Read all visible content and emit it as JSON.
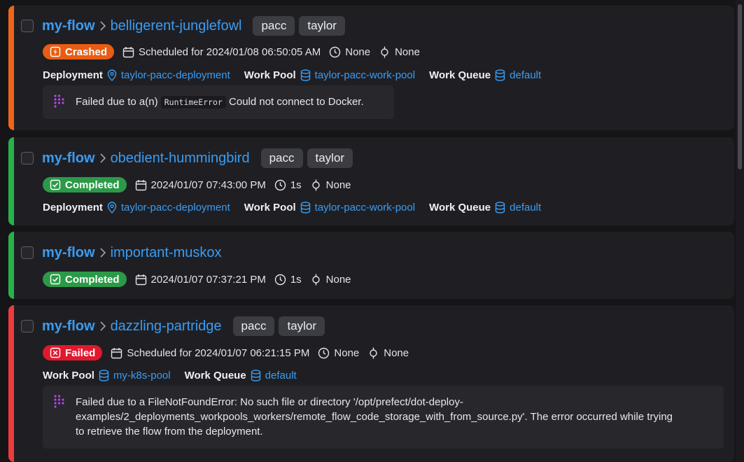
{
  "colors": {
    "crashed": "#e85d13",
    "completed": "#2b9a48",
    "failed": "#e1192e",
    "bar_crashed": "#f0641a",
    "bar_completed": "#26b24a",
    "bar_failed": "#ef3b3b",
    "link": "#3b9cf2",
    "card": "#1f1f23",
    "background": "#151518"
  },
  "runs": [
    {
      "flow": "my-flow",
      "run": "belligerent-junglefowl",
      "tags": [
        "pacc",
        "taylor"
      ],
      "state": "Crashed",
      "state_icon": "lightning-icon",
      "time": "Scheduled for 2024/01/08 06:50:05 AM",
      "duration": "None",
      "task_runs": "None",
      "deployment_label": "Deployment",
      "deployment": "taylor-pacc-deployment",
      "work_pool_label": "Work Pool",
      "work_pool": "taylor-pacc-work-pool",
      "work_queue_label": "Work Queue",
      "work_queue": "default",
      "message_prefix": "Failed due to a(n)",
      "message_code": "RuntimeError",
      "message_suffix": "Could not connect to Docker."
    },
    {
      "flow": "my-flow",
      "run": "obedient-hummingbird",
      "tags": [
        "pacc",
        "taylor"
      ],
      "state": "Completed",
      "state_icon": "check-icon",
      "time": "2024/01/07 07:43:00 PM",
      "duration": "1s",
      "task_runs": "None",
      "deployment_label": "Deployment",
      "deployment": "taylor-pacc-deployment",
      "work_pool_label": "Work Pool",
      "work_pool": "taylor-pacc-work-pool",
      "work_queue_label": "Work Queue",
      "work_queue": "default"
    },
    {
      "flow": "my-flow",
      "run": "important-muskox",
      "state": "Completed",
      "state_icon": "check-icon",
      "time": "2024/01/07 07:37:21 PM",
      "duration": "1s",
      "task_runs": "None"
    },
    {
      "flow": "my-flow",
      "run": "dazzling-partridge",
      "tags": [
        "pacc",
        "taylor"
      ],
      "state": "Failed",
      "state_icon": "x-icon",
      "time": "Scheduled for 2024/01/07 06:21:15 PM",
      "duration": "None",
      "task_runs": "None",
      "work_pool_label": "Work Pool",
      "work_pool": "my-k8s-pool",
      "work_queue_label": "Work Queue",
      "work_queue": "default",
      "message_lines": [
        "Failed due to a FileNotFoundError: No such file or directory '/opt/prefect/dot-deploy-",
        "examples/2_deployments_workpools_workers/remote_flow_code_storage_with_from_source.py'. The error occurred while trying",
        "to retrieve the flow from the deployment."
      ]
    }
  ]
}
